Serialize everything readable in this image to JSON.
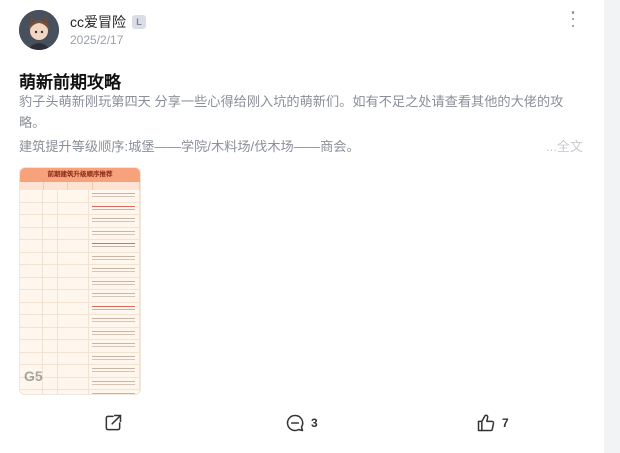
{
  "author": {
    "name": "cc爱冒险",
    "level_badge": "L",
    "date": "2025/2/17"
  },
  "post": {
    "title": "萌新前期攻略",
    "body": "豹子头萌新刚玩第四天 分享一些心得给刚入坑的萌新们。如有不足之处请查看其他的大佬的攻略。",
    "body_line2": "建筑提升等级顺序:城堡——学院/木料场/伐木场——商会。",
    "full_text_label": "...全文"
  },
  "image": {
    "banner": "前期建筑升级顺序推荐",
    "watermark": "G5"
  },
  "actions": {
    "share_icon": "share-icon",
    "comment_icon": "comment-icon",
    "comment_count": "3",
    "like_icon": "thumbs-up-icon",
    "like_count": "7"
  },
  "colors": {
    "accent_banner": "#f7a27a",
    "meta_gray": "#9aa0aa"
  }
}
